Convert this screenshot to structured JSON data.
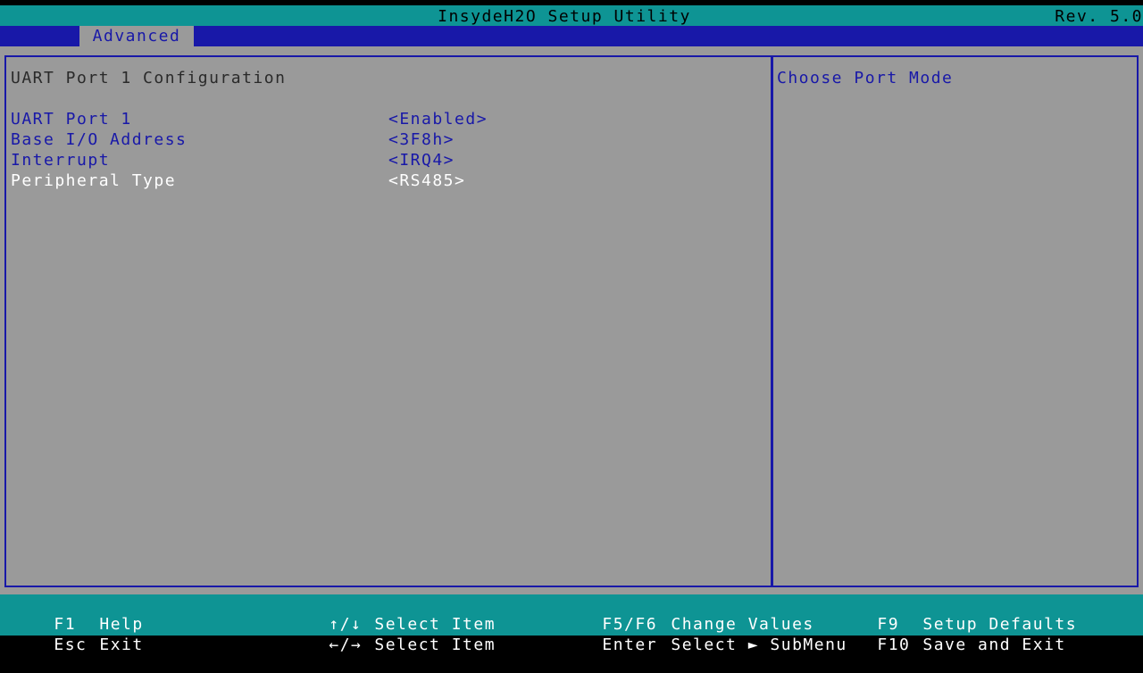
{
  "title_bar": {
    "title": "InsydeH2O Setup Utility",
    "revision": "Rev. 5.0"
  },
  "menu": {
    "tabs": [
      {
        "label": "Advanced",
        "active": true
      }
    ]
  },
  "main": {
    "section_title": "UART Port 1 Configuration",
    "options": [
      {
        "label": "UART Port 1",
        "value": "<Enabled>",
        "selected": false
      },
      {
        "label": "Base I/O Address",
        "value": "<3F8h>",
        "selected": false
      },
      {
        "label": "Interrupt",
        "value": "<IRQ4>",
        "selected": false
      },
      {
        "label": "Peripheral Type",
        "value": "<RS485>",
        "selected": true
      }
    ]
  },
  "help": {
    "text": "Choose Port Mode"
  },
  "footer": {
    "col1": [
      {
        "key": "F1",
        "action": "Help"
      },
      {
        "key": "Esc",
        "action": "Exit"
      }
    ],
    "col2": [
      {
        "key": "↑/↓",
        "action": "Select Item"
      },
      {
        "key": "←/→",
        "action": "Select Item"
      }
    ],
    "col3": [
      {
        "key": "F5/F6",
        "action": "Change Values"
      },
      {
        "key": "Enter",
        "action": "Select ► SubMenu"
      }
    ],
    "col4": [
      {
        "key": "F9",
        "action": "Setup Defaults"
      },
      {
        "key": "F10",
        "action": "Save and Exit"
      }
    ]
  },
  "colors": {
    "title_bar": "#0e9494",
    "menu_bar": "#1818a8",
    "panel_bg": "#9a9a9a",
    "option_text": "#1818a8",
    "selected_text": "#ffffff"
  }
}
